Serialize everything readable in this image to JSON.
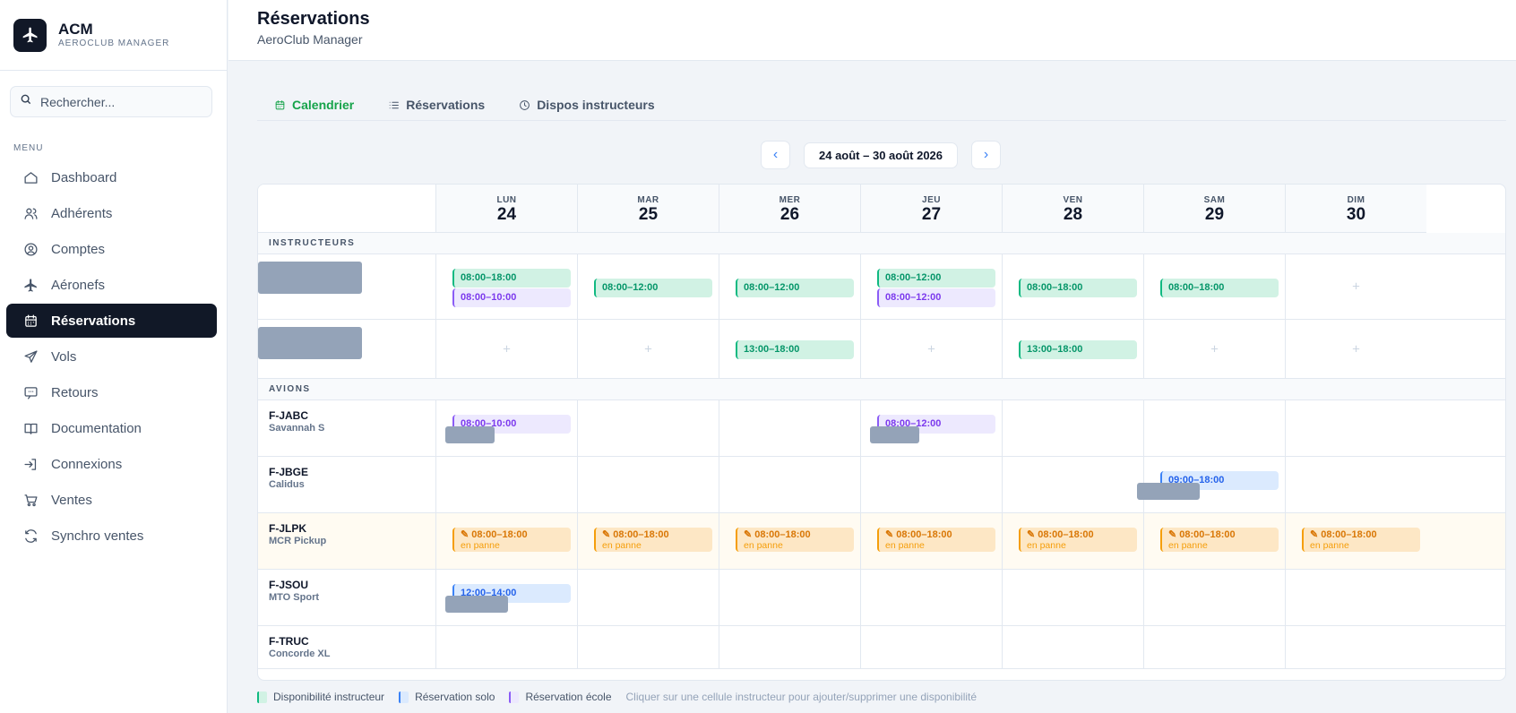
{
  "brand": {
    "title": "ACM",
    "subtitle": "AEROCLUB MANAGER"
  },
  "search": {
    "placeholder": "Rechercher..."
  },
  "menu_label": "MENU",
  "nav": [
    {
      "label": "Dashboard",
      "icon": "home-icon"
    },
    {
      "label": "Adhérents",
      "icon": "users-icon"
    },
    {
      "label": "Comptes",
      "icon": "user-circle-icon"
    },
    {
      "label": "Aéronefs",
      "icon": "plane-icon"
    },
    {
      "label": "Réservations",
      "icon": "calendar-icon",
      "active": true
    },
    {
      "label": "Vols",
      "icon": "send-icon"
    },
    {
      "label": "Retours",
      "icon": "message-icon"
    },
    {
      "label": "Documentation",
      "icon": "book-icon"
    },
    {
      "label": "Connexions",
      "icon": "login-icon"
    },
    {
      "label": "Ventes",
      "icon": "cart-icon"
    },
    {
      "label": "Synchro ventes",
      "icon": "sync-icon"
    }
  ],
  "header": {
    "title": "Réservations",
    "subtitle": "AeroClub Manager"
  },
  "tabs": [
    {
      "label": "Calendrier",
      "icon": "calendar-icon",
      "active": true
    },
    {
      "label": "Réservations",
      "icon": "list-icon"
    },
    {
      "label": "Dispos instructeurs",
      "icon": "clock-icon"
    }
  ],
  "date_nav": {
    "prev": "‹",
    "range": "24 août – 30 août 2026",
    "next": "›"
  },
  "days": [
    {
      "name": "LUN",
      "num": "24"
    },
    {
      "name": "MAR",
      "num": "25"
    },
    {
      "name": "MER",
      "num": "26"
    },
    {
      "name": "JEU",
      "num": "27"
    },
    {
      "name": "VEN",
      "num": "28"
    },
    {
      "name": "SAM",
      "num": "29"
    },
    {
      "name": "DIM",
      "num": "30"
    }
  ],
  "sections": {
    "instructors": "INSTRUCTEURS",
    "aircraft": "AVIONS"
  },
  "instructors": [
    {
      "cells": [
        [
          {
            "type": "green",
            "text": "08:00–18:00"
          },
          {
            "type": "purple",
            "text": "08:00–10:00"
          }
        ],
        [
          {
            "type": "green",
            "text": "08:00–12:00"
          }
        ],
        [
          {
            "type": "green",
            "text": "08:00–12:00"
          }
        ],
        [
          {
            "type": "green",
            "text": "08:00–12:00"
          },
          {
            "type": "purple",
            "text": "08:00–12:00"
          }
        ],
        [
          {
            "type": "green",
            "text": "08:00–18:00"
          }
        ],
        [
          {
            "type": "green",
            "text": "08:00–18:00"
          }
        ],
        []
      ]
    },
    {
      "cells": [
        [],
        [],
        [
          {
            "type": "green",
            "text": "13:00–18:00"
          }
        ],
        [],
        [
          {
            "type": "green",
            "text": "13:00–18:00"
          }
        ],
        [],
        []
      ]
    }
  ],
  "aircraft": [
    {
      "reg": "F-JABC",
      "model": "Savannah S",
      "cells": [
        [
          {
            "type": "purple",
            "text": "08:00–10:00"
          }
        ],
        [],
        [],
        [
          {
            "type": "purple",
            "text": "08:00–12:00"
          }
        ],
        [],
        [],
        []
      ]
    },
    {
      "reg": "F-JBGE",
      "model": "Calidus",
      "cells": [
        [],
        [],
        [],
        [],
        [],
        [
          {
            "type": "blue",
            "text": "09:00–18:00"
          }
        ],
        []
      ]
    },
    {
      "reg": "F-JLPK",
      "model": "MCR Pickup",
      "panne": true,
      "cells": [
        [
          {
            "type": "orange",
            "text": "08:00–18:00",
            "sub": "en panne"
          }
        ],
        [
          {
            "type": "orange",
            "text": "08:00–18:00",
            "sub": "en panne"
          }
        ],
        [
          {
            "type": "orange",
            "text": "08:00–18:00",
            "sub": "en panne"
          }
        ],
        [
          {
            "type": "orange",
            "text": "08:00–18:00",
            "sub": "en panne"
          }
        ],
        [
          {
            "type": "orange",
            "text": "08:00–18:00",
            "sub": "en panne"
          }
        ],
        [
          {
            "type": "orange",
            "text": "08:00–18:00",
            "sub": "en panne"
          }
        ],
        [
          {
            "type": "orange",
            "text": "08:00–18:00",
            "sub": "en panne"
          }
        ]
      ]
    },
    {
      "reg": "F-JSOU",
      "model": "MTO Sport",
      "cells": [
        [
          {
            "type": "blue",
            "text": "12:00–14:00"
          }
        ],
        [],
        [],
        [],
        [],
        [],
        []
      ]
    },
    {
      "reg": "F-TRUC",
      "model": "Concorde XL",
      "cells": [
        [],
        [],
        [],
        [],
        [],
        [],
        []
      ]
    }
  ],
  "plus_symbol": "+",
  "wrench_symbol": "✎",
  "legend": {
    "items": [
      {
        "label": "Disponibilité instructeur",
        "color": "#10b981",
        "bg": "#d1f2e4"
      },
      {
        "label": "Réservation solo",
        "color": "#3b82f6",
        "bg": "#dbeafe"
      },
      {
        "label": "Réservation école",
        "color": "#8b5cf6",
        "bg": "#ede9fe"
      }
    ],
    "hint": "Cliquer sur une cellule instructeur pour ajouter/supprimer une disponibilité"
  },
  "colors": {
    "accent": "#16a34a",
    "dark": "#111827",
    "blue": "#3b82f6"
  }
}
